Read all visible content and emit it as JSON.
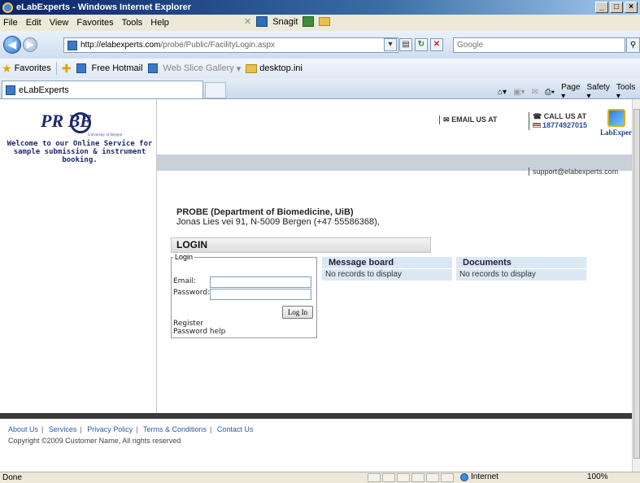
{
  "window": {
    "title": "eLabExperts - Windows Internet Explorer",
    "controls": [
      "_",
      "□",
      "×"
    ]
  },
  "menu": {
    "items": [
      "File",
      "Edit",
      "View",
      "Favorites",
      "Tools",
      "Help"
    ],
    "snagit": "Snagit"
  },
  "address": {
    "host": "http://elabexperts.com",
    "path": "/probe/Public/FacilityLogin.aspx",
    "search_placeholder": "Google"
  },
  "favorites": {
    "label": "Favorites",
    "items": [
      "Free Hotmail",
      "Web Slice Gallery",
      "desktop.ini"
    ]
  },
  "tab": {
    "title": "eLabExperts"
  },
  "commandbar": {
    "page": "Page",
    "safety": "Safety",
    "tools": "Tools"
  },
  "site": {
    "logo_text": "PR  BE",
    "logo_sub": "University of Bergen",
    "welcome": "Welcome to our Online Service for sample submission & instrument booking.",
    "email_label": "EMAIL US AT",
    "call_label": "CALL US AT",
    "phone": "18774927015",
    "lab_logo": "LabExperts",
    "support": "support@elabexperts.com",
    "dept_name": "PROBE (Department of Biomedicine, UiB)",
    "dept_address": "Jonas Lies vei 91, N-5009 Bergen (+47 55586368),",
    "login_header": "LOGIN"
  },
  "login": {
    "legend": "Login",
    "email_label": "Email:",
    "password_label": "Password:",
    "email_value": "",
    "password_value": "",
    "button": "Log In",
    "register": "Register",
    "password_help": "Password help"
  },
  "panels": {
    "message_board": {
      "title": "Message board",
      "body": "No records to display"
    },
    "documents": {
      "title": "Documents",
      "body": "No records to display"
    }
  },
  "footer": {
    "links": [
      "About Us",
      "Services",
      "Privacy Policy",
      "Terms & Conditions",
      "Contact Us"
    ],
    "copyright": "Copyright ©2009 Customer Name, All rights reserved"
  },
  "status": {
    "text": "Done",
    "zone": "Internet",
    "zoom": "100%"
  }
}
